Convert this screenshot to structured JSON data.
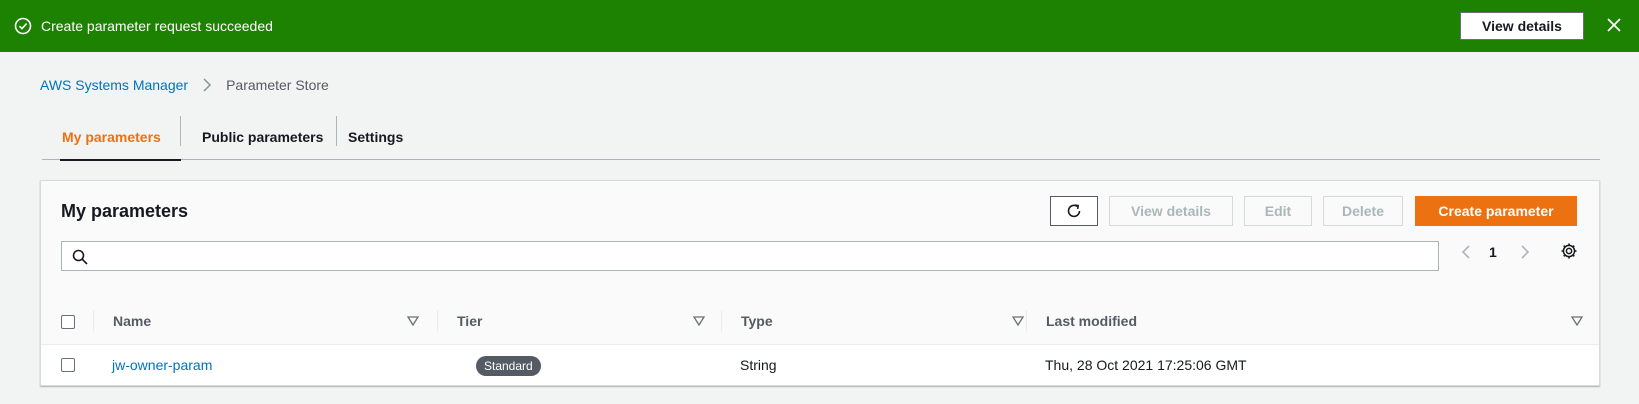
{
  "flash": {
    "message": "Create parameter request succeeded",
    "view_details_label": "View details",
    "color": "#1d8102"
  },
  "breadcrumb": {
    "items": [
      "AWS Systems Manager",
      "Parameter Store"
    ]
  },
  "tabs": [
    {
      "label": "My parameters",
      "active": true
    },
    {
      "label": "Public parameters",
      "active": false
    },
    {
      "label": "Settings",
      "active": false
    }
  ],
  "panel": {
    "title": "My parameters",
    "buttons": {
      "refresh_icon": "refresh-icon",
      "view_details": "View details",
      "edit": "Edit",
      "delete": "Delete",
      "create": "Create parameter"
    },
    "search": {
      "placeholder": "",
      "value": ""
    },
    "pagination": {
      "current_page": "1"
    }
  },
  "table": {
    "columns": [
      "Name",
      "Tier",
      "Type",
      "Last modified"
    ],
    "rows": [
      {
        "name": "jw-owner-param",
        "tier": "Standard",
        "type": "String",
        "last_modified": "Thu, 28 Oct 2021 17:25:06 GMT"
      }
    ]
  },
  "colors": {
    "accent": "#ec7211",
    "link": "#0073bb"
  }
}
